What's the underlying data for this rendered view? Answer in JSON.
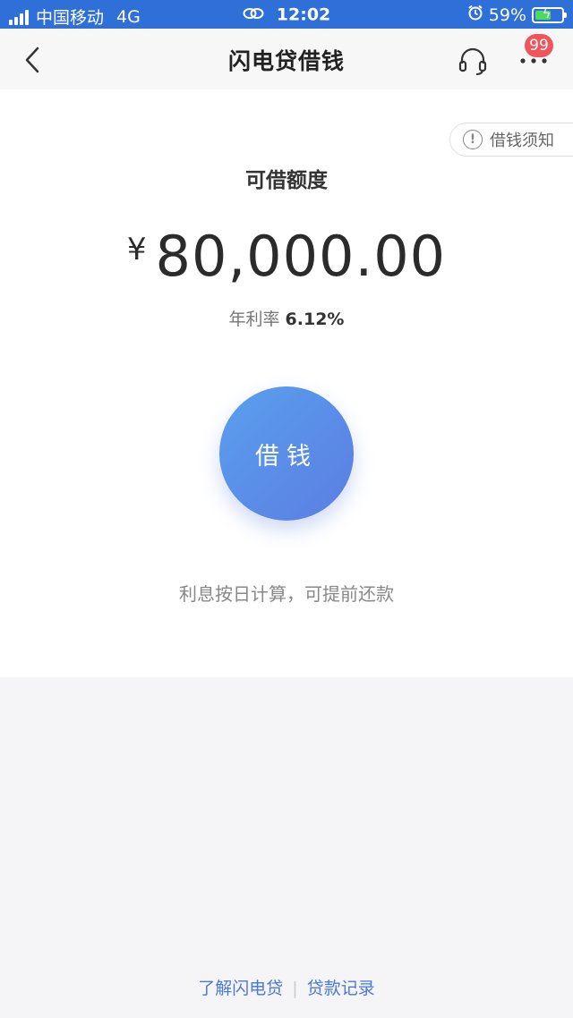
{
  "status_bar": {
    "carrier": "中国移动",
    "network": "4G",
    "time": "12:02",
    "battery_percent": "59%",
    "battery_level": 0.59
  },
  "nav": {
    "title": "闪电贷借钱",
    "badge_count": "99"
  },
  "card": {
    "notice_label": "借钱须知",
    "quota_label": "可借额度",
    "currency_symbol": "¥",
    "amount": "80,000.00",
    "rate_label": "年利率",
    "rate_value": "6.12%",
    "borrow_button_label": "借钱",
    "tip": "利息按日计算，可提前还款"
  },
  "footer": {
    "link_about": "了解闪电贷",
    "separator": "|",
    "link_records": "贷款记录"
  },
  "colors": {
    "status_bar_bg": "#2f6fd8",
    "accent_blue": "#4a78d6",
    "badge_red": "#f2545b",
    "battery_green": "#4cd964"
  }
}
